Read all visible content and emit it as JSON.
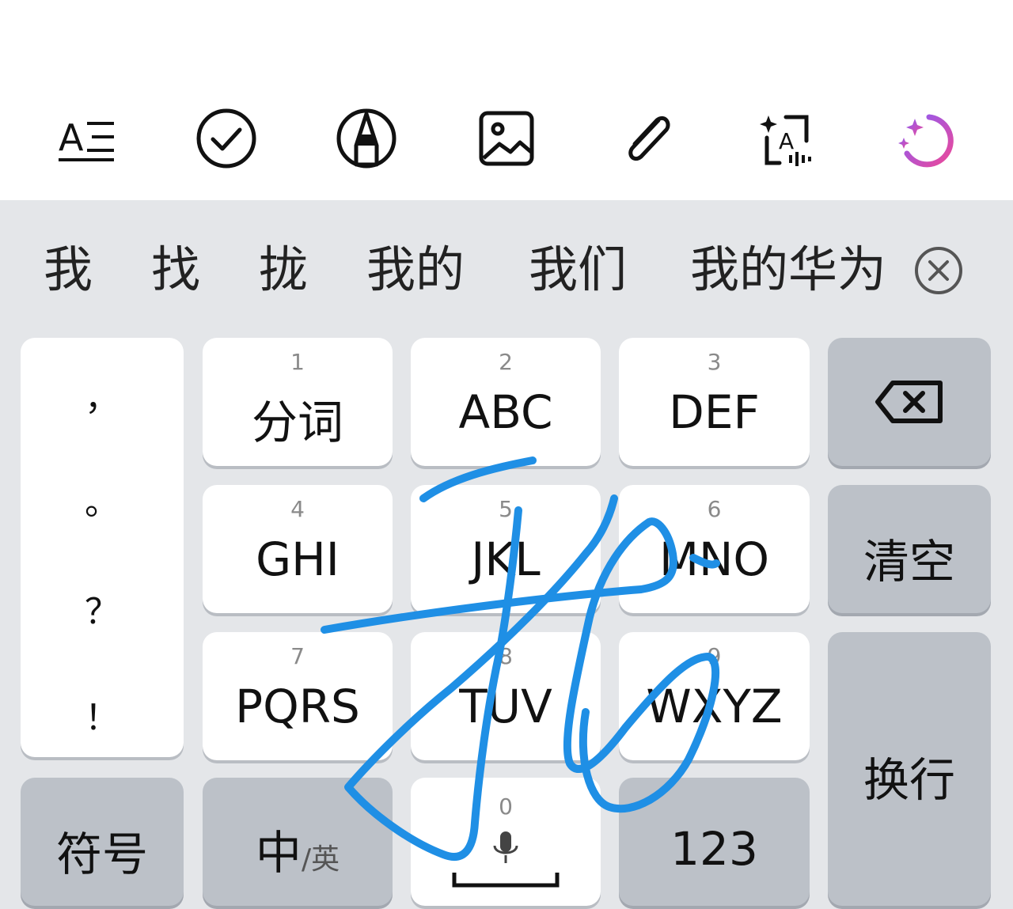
{
  "toolbar": {
    "icons": [
      "text-format-icon",
      "checklist-icon",
      "pen-icon",
      "image-icon",
      "attachment-icon",
      "ai-text-icon",
      "ai-assistant-icon"
    ]
  },
  "candidates": {
    "items": [
      "我",
      "找",
      "拢",
      "我的",
      "我们",
      "我的华为"
    ]
  },
  "keys": {
    "punct": [
      "，",
      "。",
      "？",
      "！"
    ],
    "k1": {
      "num": "1",
      "label": "分词"
    },
    "k2": {
      "num": "2",
      "label": "ABC"
    },
    "k3": {
      "num": "3",
      "label": "DEF"
    },
    "k4": {
      "num": "4",
      "label": "GHI"
    },
    "k5": {
      "num": "5",
      "label": "JKL"
    },
    "k6": {
      "num": "6",
      "label": "MNO"
    },
    "k7": {
      "num": "7",
      "label": "PQRS"
    },
    "k8": {
      "num": "8",
      "label": "TUV"
    },
    "k9": {
      "num": "9",
      "label": "WXYZ"
    },
    "k0": {
      "num": "0"
    },
    "clear": "清空",
    "enter": "换行",
    "symbols": "符号",
    "lang_main": "中",
    "lang_alt": "/英",
    "numeric": "123"
  },
  "colors": {
    "ink": "#1f8fe5",
    "ai_gradient_start": "#8b5cf6",
    "ai_gradient_end": "#ec4899"
  }
}
